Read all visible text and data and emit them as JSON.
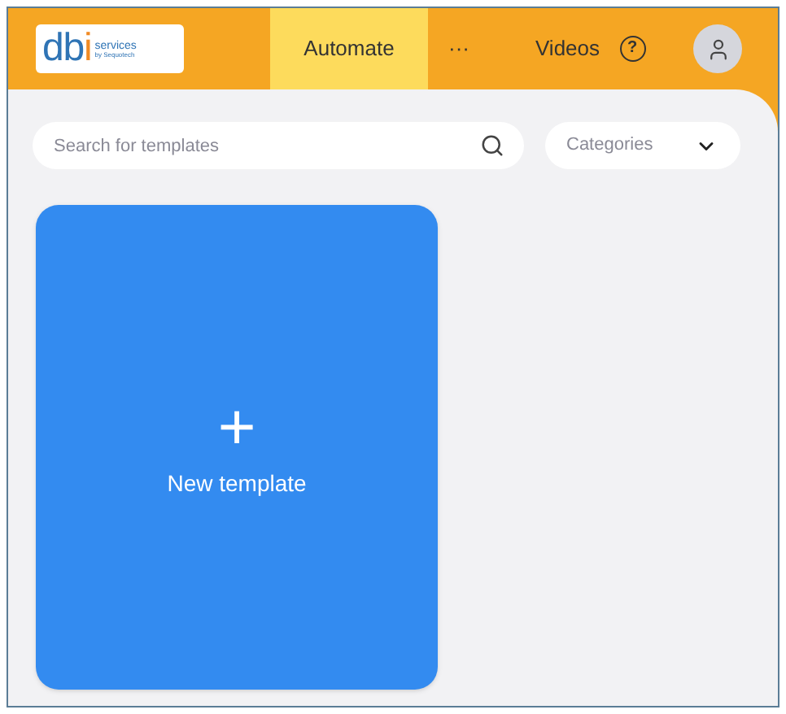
{
  "logo": {
    "wordmark": "db",
    "letter": "i",
    "tagline": "services",
    "byline": "by Sequotech"
  },
  "nav": [
    {
      "label": "Automate",
      "selected": true
    },
    {
      "label": "···",
      "selected": false
    },
    {
      "label": "Videos",
      "selected": false
    }
  ],
  "help": {
    "label": "?"
  },
  "search": {
    "placeholder": "Search for templates"
  },
  "categories": {
    "label": "Categories"
  },
  "new_template": {
    "icon": "+",
    "label": "New template"
  }
}
